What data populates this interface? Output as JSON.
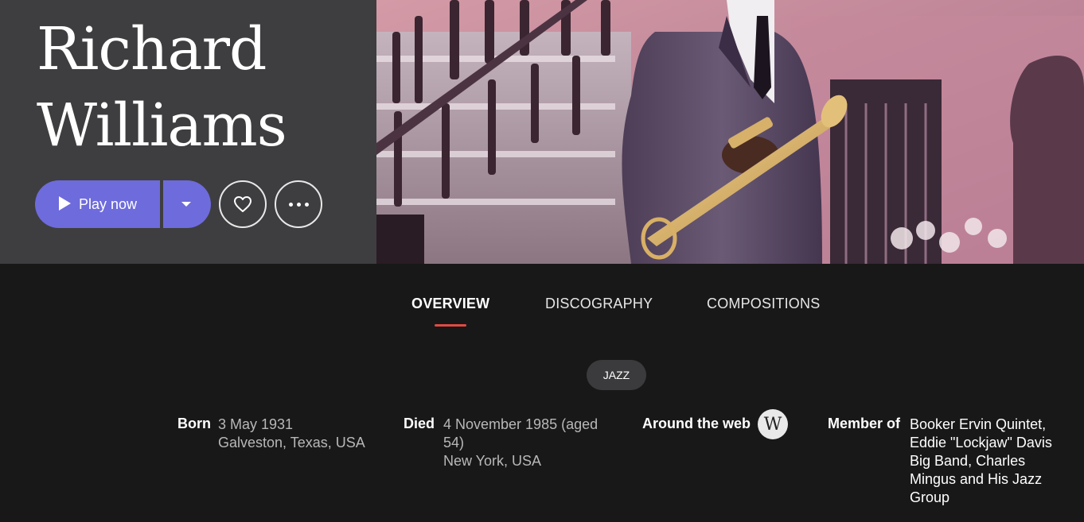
{
  "artist": {
    "name_line1": "Richard",
    "name_line2": "Williams"
  },
  "actions": {
    "play_label": "Play now",
    "play_icon": "play-icon",
    "dropdown_icon": "chevron-down-icon",
    "favorite_icon": "heart-icon",
    "more_icon": "more-icon"
  },
  "tabs": [
    {
      "label": "OVERVIEW",
      "active": true
    },
    {
      "label": "DISCOGRAPHY",
      "active": false
    },
    {
      "label": "COMPOSITIONS",
      "active": false
    }
  ],
  "genre": "JAZZ",
  "facts": {
    "born_label": "Born",
    "born_date": "3 May 1931",
    "born_place": "Galveston, Texas, USA",
    "died_label": "Died",
    "died_date_line1": "4 November 1985 (aged",
    "died_date_line2": "54)",
    "died_place": "New York, USA",
    "web_label": "Around the web",
    "web_icon_letter": "W",
    "member_label": "Member of",
    "member_groups": [
      "Booker Ervin Quintet",
      "Eddie \"Lockjaw\" Davis Big Band",
      "Charles Mingus and His Jazz Group"
    ]
  },
  "colors": {
    "accent_purple": "#6e6bdc",
    "tab_underline": "#e04b43",
    "background": "#181818",
    "hero_panel": "#3e3e40"
  }
}
